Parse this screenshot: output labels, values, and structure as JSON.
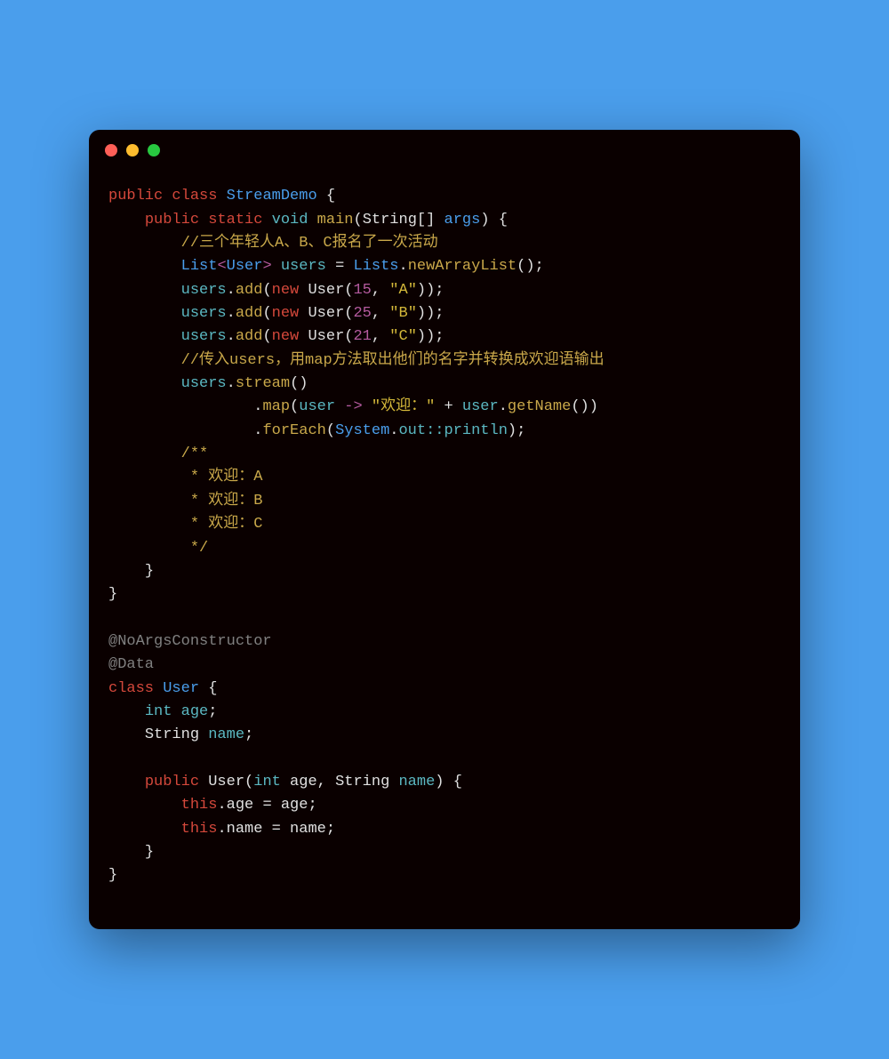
{
  "code": {
    "l1_public": "public",
    "l1_class": "class",
    "l1_name": "StreamDemo",
    "l1_brace": " {",
    "l2_public": "public",
    "l2_static": "static",
    "l2_void": "void",
    "l2_main": "main",
    "l2_paren1": "(",
    "l2_string": "String",
    "l2_brackets": "[] ",
    "l2_args": "args",
    "l2_paren2": ")",
    "l2_brace": " {",
    "l3_comment": "//三个年轻人A、B、C报名了一次活动",
    "l4_list": "List",
    "l4_lt": "<",
    "l4_user": "User",
    "l4_gt": ">",
    "l4_users": " users ",
    "l4_eq": "= ",
    "l4_lists": "Lists",
    "l4_dot": ".",
    "l4_newarr": "newArrayList",
    "l4_end": "();",
    "l5_users": "users",
    "l5_dot": ".",
    "l5_add": "add",
    "l5_p1": "(",
    "l5_new": "new",
    "l5_user": " User",
    "l5_p2": "(",
    "l5_num": "15",
    "l5_comma": ", ",
    "l5_str": "\"A\"",
    "l5_end": "));",
    "l6_users": "users",
    "l6_dot": ".",
    "l6_add": "add",
    "l6_p1": "(",
    "l6_new": "new",
    "l6_user": " User",
    "l6_p2": "(",
    "l6_num": "25",
    "l6_comma": ", ",
    "l6_str": "\"B\"",
    "l6_end": "));",
    "l7_users": "users",
    "l7_dot": ".",
    "l7_add": "add",
    "l7_p1": "(",
    "l7_new": "new",
    "l7_user": " User",
    "l7_p2": "(",
    "l7_num": "21",
    "l7_comma": ", ",
    "l7_str": "\"C\"",
    "l7_end": "));",
    "l8_comment": "//传入users，用map方法取出他们的名字并转换成欢迎语输出",
    "l9_users": "users",
    "l9_dot": ".",
    "l9_stream": "stream",
    "l9_end": "()",
    "l10_dot": ".",
    "l10_map": "map",
    "l10_p1": "(",
    "l10_user": "user ",
    "l10_arrow": "->",
    "l10_sp": " ",
    "l10_str": "\"欢迎：\"",
    "l10_plus": " + ",
    "l10_user2": "user",
    "l10_dot2": ".",
    "l10_getname": "getName",
    "l10_end": "())",
    "l11_dot": ".",
    "l11_foreach": "forEach",
    "l11_p1": "(",
    "l11_system": "System",
    "l11_dot2": ".",
    "l11_out": "out",
    "l11_colon": "::",
    "l11_println": "println",
    "l11_end": ");",
    "l12_c": "/**",
    "l13_c": " * 欢迎：A",
    "l14_c": " * 欢迎：B",
    "l15_c": " * 欢迎：C",
    "l16_c": " */",
    "l17_brace": "}",
    "l18_brace": "}",
    "l20_ann": "@NoArgsConstructor",
    "l21_ann": "@Data",
    "l22_class": "class",
    "l22_user": "User",
    "l22_brace": " {",
    "l23_int": "int",
    "l23_age": " age",
    "l23_semi": ";",
    "l24_string": "String ",
    "l24_name": "name",
    "l24_semi": ";",
    "l26_public": "public",
    "l26_user": " User",
    "l26_p1": "(",
    "l26_int": "int",
    "l26_age": " age, String ",
    "l26_name": "name",
    "l26_p2": ")",
    "l26_brace": " {",
    "l27_this": "this",
    "l27_rest": ".age = age;",
    "l28_this": "this",
    "l28_rest": ".name = name;",
    "l29_brace": "}",
    "l30_brace": "}"
  }
}
